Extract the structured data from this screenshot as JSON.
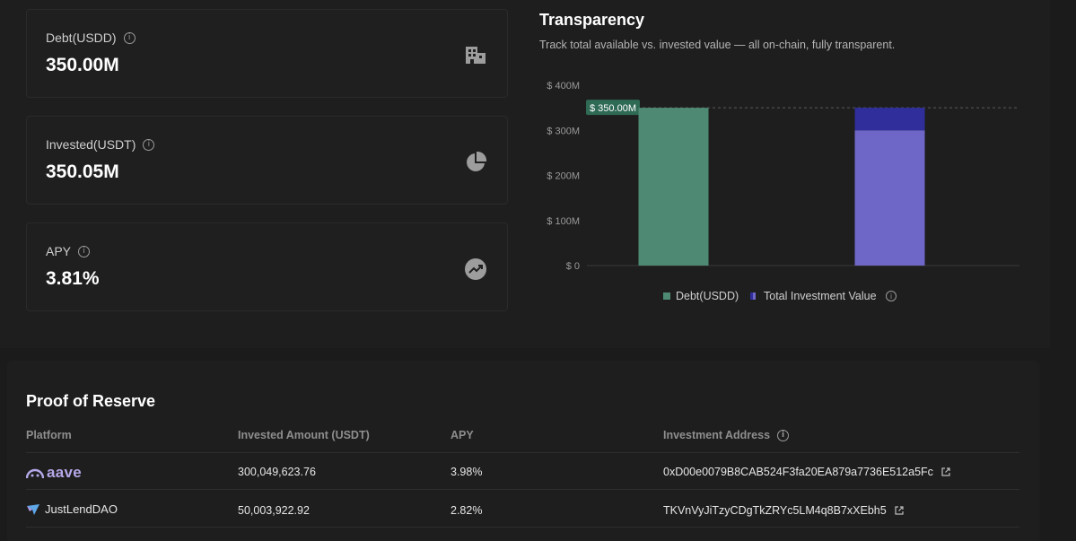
{
  "stats": [
    {
      "label": "Debt(USDD)",
      "value": "350.00M",
      "icon": "building-icon"
    },
    {
      "label": "Invested(USDT)",
      "value": "350.05M",
      "icon": "pie-chart-icon"
    },
    {
      "label": "APY",
      "value": "3.81%",
      "icon": "trending-up-icon"
    }
  ],
  "transparency": {
    "title": "Transparency",
    "subtitle": "Track total available vs. invested value — all on-chain, fully transparent."
  },
  "chart_data": {
    "type": "bar",
    "y_tick_labels": [
      "$ 0",
      "$ 100M",
      "$ 200M",
      "$ 300M",
      "$ 400M"
    ],
    "ylim": [
      0,
      400
    ],
    "reference_line": {
      "value": 350,
      "label": "$ 350.00M"
    },
    "bars": [
      {
        "series": "Debt(USDD)",
        "segments": [
          {
            "value": 350.0,
            "color": "#4e8a73"
          }
        ]
      },
      {
        "series": "Total Investment Value",
        "segments": [
          {
            "value": 300.05,
            "color": "#6e67c8"
          },
          {
            "value": 50.0,
            "color": "#2f2e9a"
          }
        ]
      }
    ],
    "legend": [
      {
        "name": "Debt(USDD)",
        "color": "#4e8a73"
      },
      {
        "name": "Total Investment Value",
        "color": "#6e67c8"
      }
    ],
    "legend_position": "bottom",
    "grid": false
  },
  "reserve": {
    "title": "Proof of Reserve",
    "headers": {
      "platform": "Platform",
      "amount": "Invested Amount (USDT)",
      "apy": "APY",
      "address": "Investment Address"
    },
    "rows": [
      {
        "platform": "aave",
        "amount": "300,049,623.76",
        "apy": "3.98%",
        "address": "0xD00e0079B8CAB524F3fa20EA879a7736E512a5Fc"
      },
      {
        "platform": "JustLendDAO",
        "amount": "50,003,922.92",
        "apy": "2.82%",
        "address": "TKVnVyJiTzyCDgTkZRYc5LM4q8B7xXEbh5"
      }
    ]
  }
}
